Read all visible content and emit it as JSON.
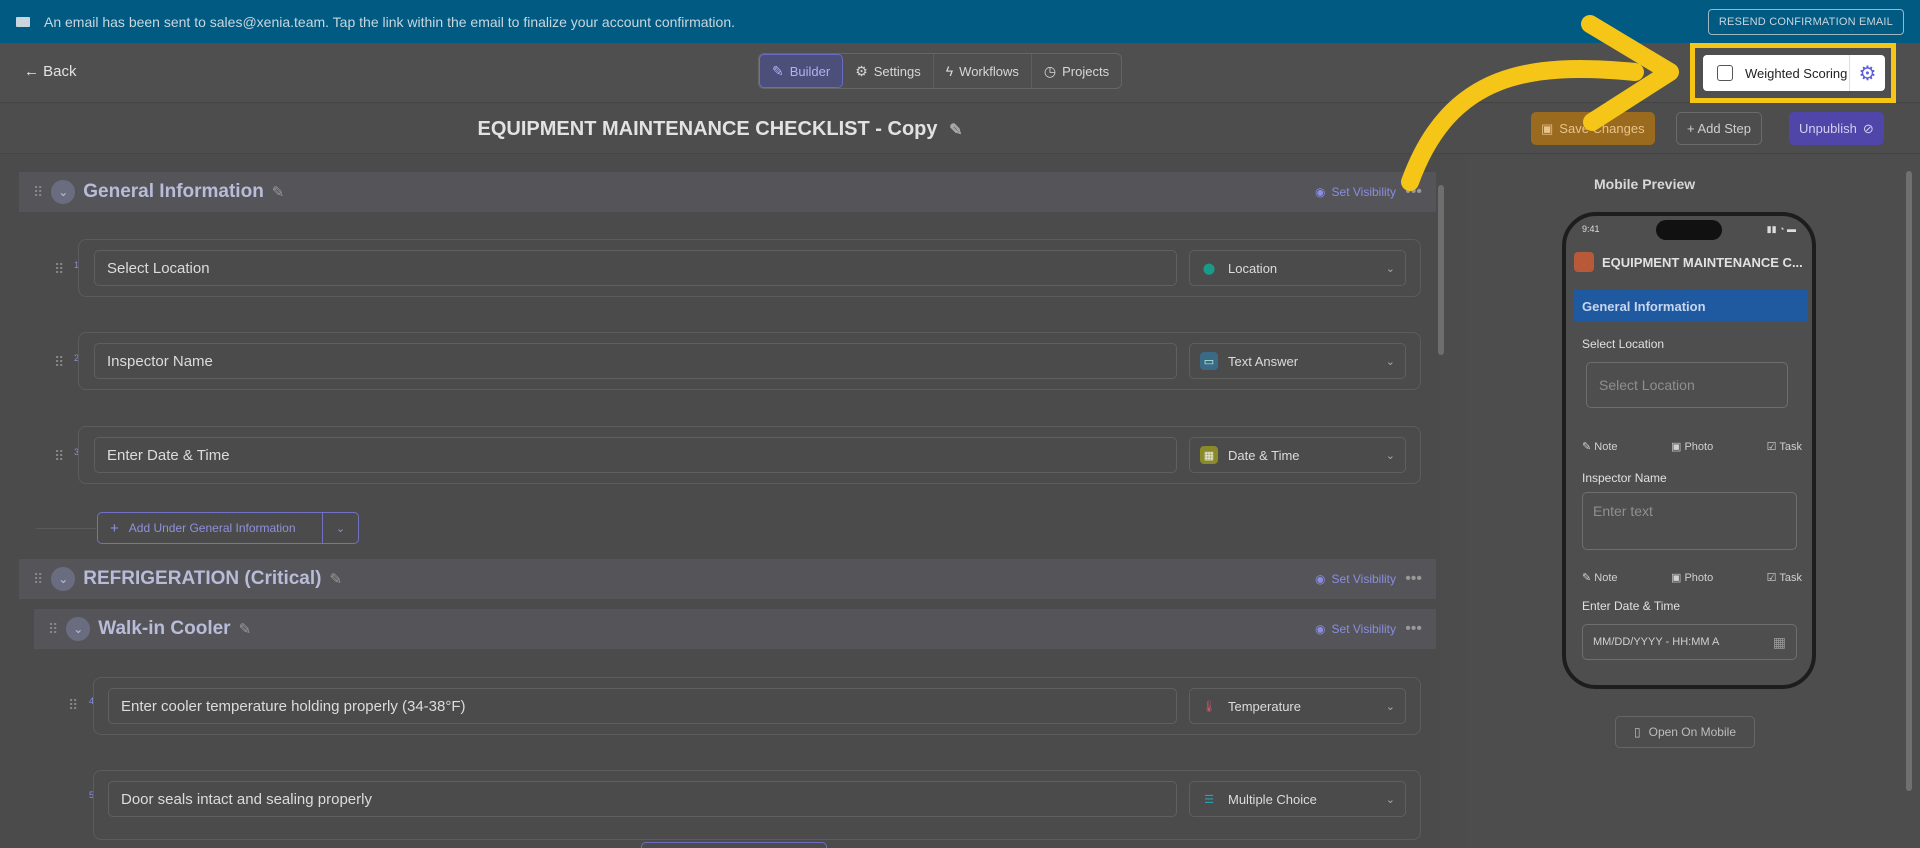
{
  "banner": {
    "message": "An email has been sent to sales@xenia.team. Tap the link within the email to finalize your account confirmation.",
    "resend_label": "RESEND CONFIRMATION EMAIL"
  },
  "nav": {
    "back_label": "Back",
    "tabs": [
      {
        "label": "Builder",
        "icon": "edit-icon",
        "active": true
      },
      {
        "label": "Settings",
        "icon": "gear-icon",
        "active": false
      },
      {
        "label": "Workflows",
        "icon": "bolt-icon",
        "active": false
      },
      {
        "label": "Projects",
        "icon": "clock-icon",
        "active": false
      }
    ]
  },
  "header": {
    "title": "EQUIPMENT MAINTENANCE CHECKLIST - Copy",
    "save_label": "Save Changes",
    "add_step_label": "+ Add Step",
    "unpublish_label": "Unpublish"
  },
  "weighted_scoring": {
    "label": "Weighted Scoring",
    "checked": false,
    "highlight_color": "#f5c518"
  },
  "builder": {
    "set_visibility_label": "Set Visibility",
    "sections": [
      {
        "name": "General Information"
      },
      {
        "name": "REFRIGERATION (Critical)"
      },
      {
        "name": "Walk-in Cooler"
      }
    ],
    "questions": [
      {
        "number": "1",
        "text": "Select Location",
        "type": "Location",
        "type_color": "#1a9a8a"
      },
      {
        "number": "2",
        "text": "Inspector Name",
        "type": "Text Answer",
        "type_color": "#3a7aa0"
      },
      {
        "number": "3",
        "text": "Enter Date & Time",
        "type": "Date & Time",
        "type_color": "#9a9a2a"
      },
      {
        "number": "4",
        "text": "Enter cooler temperature holding properly (34-38°F)",
        "type": "Temperature",
        "type_color": "#c2455a"
      },
      {
        "number": "5",
        "text": "Door seals intact and sealing properly",
        "type": "Multiple Choice",
        "type_color": "#2a8aa0"
      }
    ],
    "add_under_label": "Add Under General Information"
  },
  "preview": {
    "title": "Mobile Preview",
    "time": "9:41",
    "checklist_name": "EQUIPMENT MAINTENANCE C...",
    "section": "General Information",
    "fields": [
      {
        "label": "Select Location",
        "placeholder": "Select Location"
      },
      {
        "label": "Inspector Name",
        "placeholder": "Enter text"
      },
      {
        "label": "Enter Date & Time",
        "placeholder": "MM/DD/YYYY - HH:MM A"
      }
    ],
    "actions": [
      "Note",
      "Photo",
      "Task"
    ],
    "open_mobile_label": "Open On Mobile"
  }
}
